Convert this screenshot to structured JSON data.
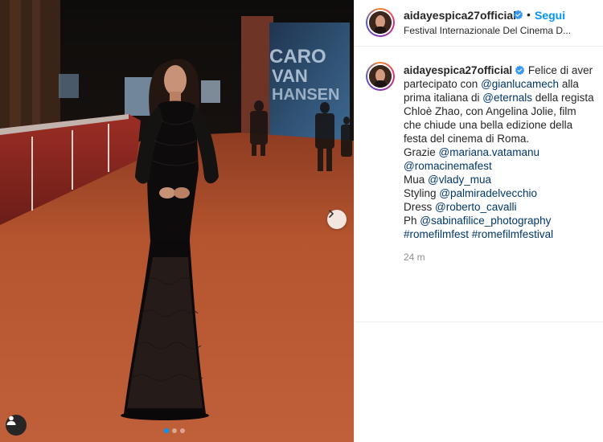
{
  "post": {
    "username": "aidayespica27official",
    "verified": true,
    "bullet": "•",
    "follow_label": "Segui",
    "location": "Festival Internazionale Del Cinema D..."
  },
  "caption": {
    "username": "aidayespica27official",
    "segments": [
      {
        "t": "Felice di aver partecipato con ",
        "k": "text"
      },
      {
        "t": "@gianlucamech",
        "k": "mention"
      },
      {
        "t": " alla prima italiana di ",
        "k": "text"
      },
      {
        "t": "@eternals",
        "k": "mention"
      },
      {
        "t": " della regista Chloè Zhao, con Angelina Jolie, film che chiude una bella edizione della festa del cinema di Roma.",
        "k": "text"
      },
      {
        "t": "\nGrazie ",
        "k": "text"
      },
      {
        "t": "@mariana.vatamanu",
        "k": "mention"
      },
      {
        "t": "\n",
        "k": "text"
      },
      {
        "t": "@romacinemafest",
        "k": "mention"
      },
      {
        "t": "\nMua ",
        "k": "text"
      },
      {
        "t": "@vlady_mua",
        "k": "mention"
      },
      {
        "t": "\nStyling ",
        "k": "text"
      },
      {
        "t": "@palmiradelvecchio",
        "k": "mention"
      },
      {
        "t": "\nDress ",
        "k": "text"
      },
      {
        "t": "@roberto_cavalli",
        "k": "mention"
      },
      {
        "t": "\nPh ",
        "k": "text"
      },
      {
        "t": "@sabinafilice_photography",
        "k": "mention"
      },
      {
        "t": "\n",
        "k": "text"
      },
      {
        "t": "#romefilmfest",
        "k": "tag"
      },
      {
        "t": " ",
        "k": "text"
      },
      {
        "t": "#romefilmfestival",
        "k": "tag"
      }
    ],
    "timestamp": "24 m"
  },
  "media": {
    "backdrop_text": [
      "CARO",
      "VAN",
      "HANSEN"
    ],
    "carousel_count": 3,
    "carousel_active": 0
  },
  "icons": {
    "next": "chevron-right-icon",
    "user_tag": "user-icon",
    "verified": "verified-badge-icon"
  },
  "colors": {
    "accent": "#0095f6",
    "link": "#00376b",
    "carpet": "#b5552f",
    "muted": "#8e8e8e"
  }
}
